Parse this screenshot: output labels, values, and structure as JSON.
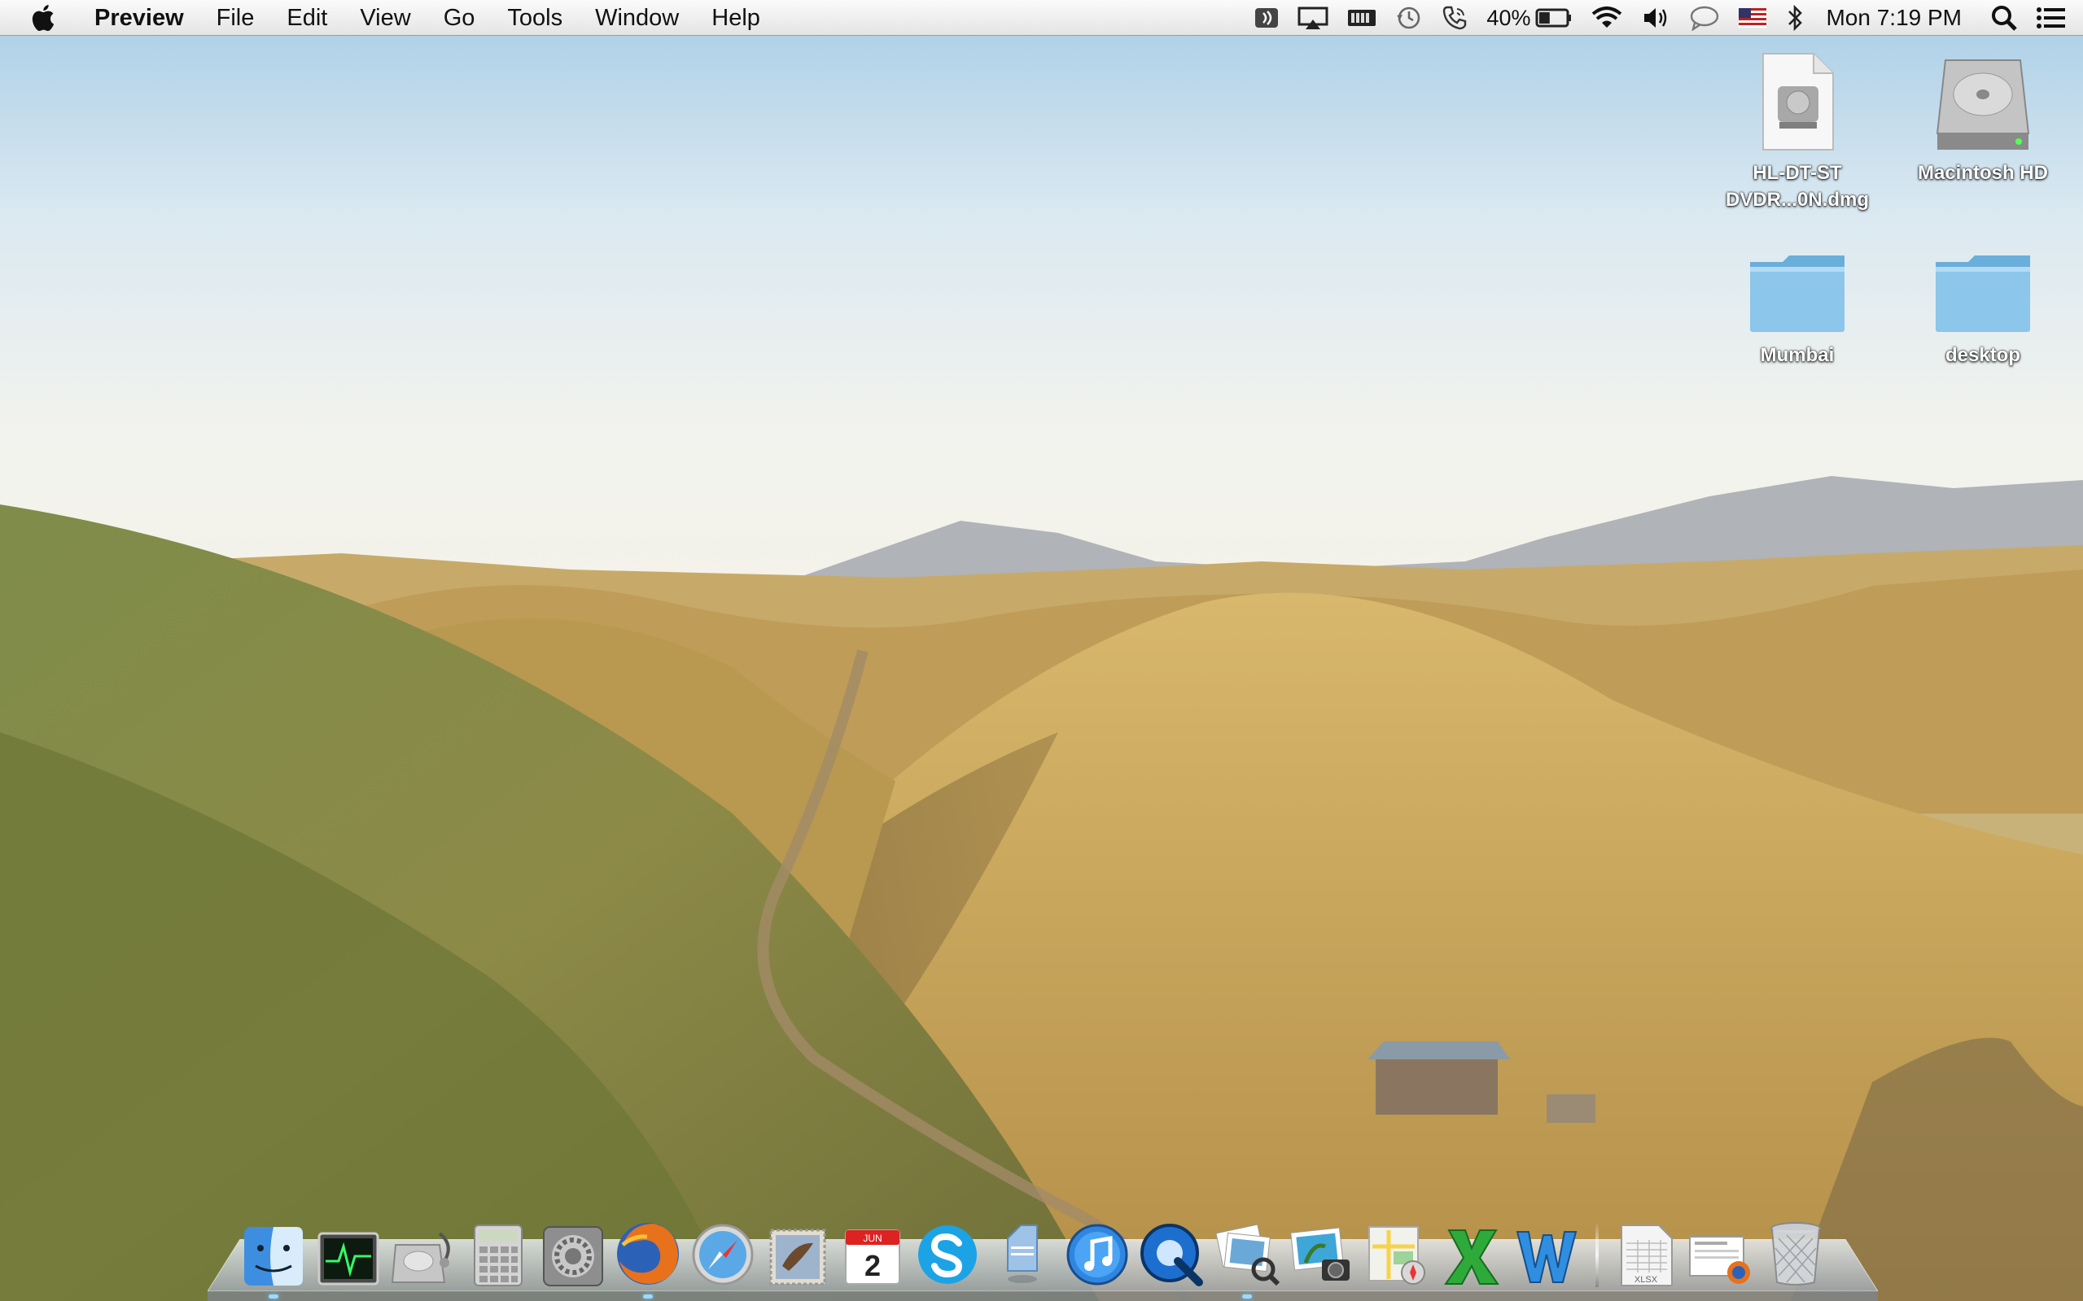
{
  "menubar": {
    "apple_icon": "apple-logo-icon",
    "app_name": "Preview",
    "menus": [
      "File",
      "Edit",
      "View",
      "Go",
      "Tools",
      "Window",
      "Help"
    ],
    "status_items": [
      {
        "name": "readiris-icon"
      },
      {
        "name": "airplay-icon"
      },
      {
        "name": "memory-status-icon"
      },
      {
        "name": "time-machine-icon"
      },
      {
        "name": "phone-icon"
      },
      {
        "name": "battery-icon",
        "text": "40%",
        "level": 0.4
      },
      {
        "name": "wifi-icon"
      },
      {
        "name": "volume-icon"
      },
      {
        "name": "messages-icon"
      },
      {
        "name": "us-flag-input-icon"
      },
      {
        "name": "bluetooth-icon"
      }
    ],
    "clock": "Mon 7:19 PM",
    "spotlight_icon": "spotlight-icon",
    "notification_icon": "notification-center-icon"
  },
  "desktop": {
    "items": [
      {
        "label_line1": "HL-DT-ST",
        "label_line2": "DVDR...0N.dmg",
        "icon": "dmg-file-icon"
      },
      {
        "label_line1": "Macintosh HD",
        "label_line2": "",
        "icon": "hard-drive-icon"
      },
      {
        "label_line1": "Mumbai",
        "label_line2": "",
        "icon": "folder-icon"
      },
      {
        "label_line1": "desktop",
        "label_line2": "",
        "icon": "folder-icon"
      }
    ]
  },
  "dock": {
    "apps": [
      {
        "name": "finder-icon",
        "running": true
      },
      {
        "name": "activity-monitor-icon",
        "running": false
      },
      {
        "name": "disk-utility-icon",
        "running": false
      },
      {
        "name": "calculator-icon",
        "running": false
      },
      {
        "name": "system-preferences-icon",
        "running": false
      },
      {
        "name": "firefox-icon",
        "running": true
      },
      {
        "name": "safari-icon",
        "running": false
      },
      {
        "name": "mail-icon",
        "running": false
      },
      {
        "name": "calendar-icon",
        "running": false,
        "calendar_month": "JUN",
        "calendar_day": "2"
      },
      {
        "name": "skype-icon",
        "running": false
      },
      {
        "name": "document-app-icon",
        "running": false
      },
      {
        "name": "itunes-icon",
        "running": false
      },
      {
        "name": "quicktime-icon",
        "running": false
      },
      {
        "name": "preview-icon",
        "running": true
      },
      {
        "name": "iphoto-icon",
        "running": false
      },
      {
        "name": "maps-icon",
        "running": false
      },
      {
        "name": "excel-icon",
        "running": false
      },
      {
        "name": "word-icon",
        "running": false
      }
    ],
    "stacks": [
      {
        "name": "xlsx-stack-icon",
        "badge": "XLSX"
      },
      {
        "name": "downloads-stack-icon"
      },
      {
        "name": "trash-icon"
      }
    ]
  },
  "colors": {
    "menubar_top": "#fbfbfb",
    "folder_blue": "#8cc6ea",
    "sky_top": "#a7cde6",
    "hill_gold": "#c8a860"
  }
}
